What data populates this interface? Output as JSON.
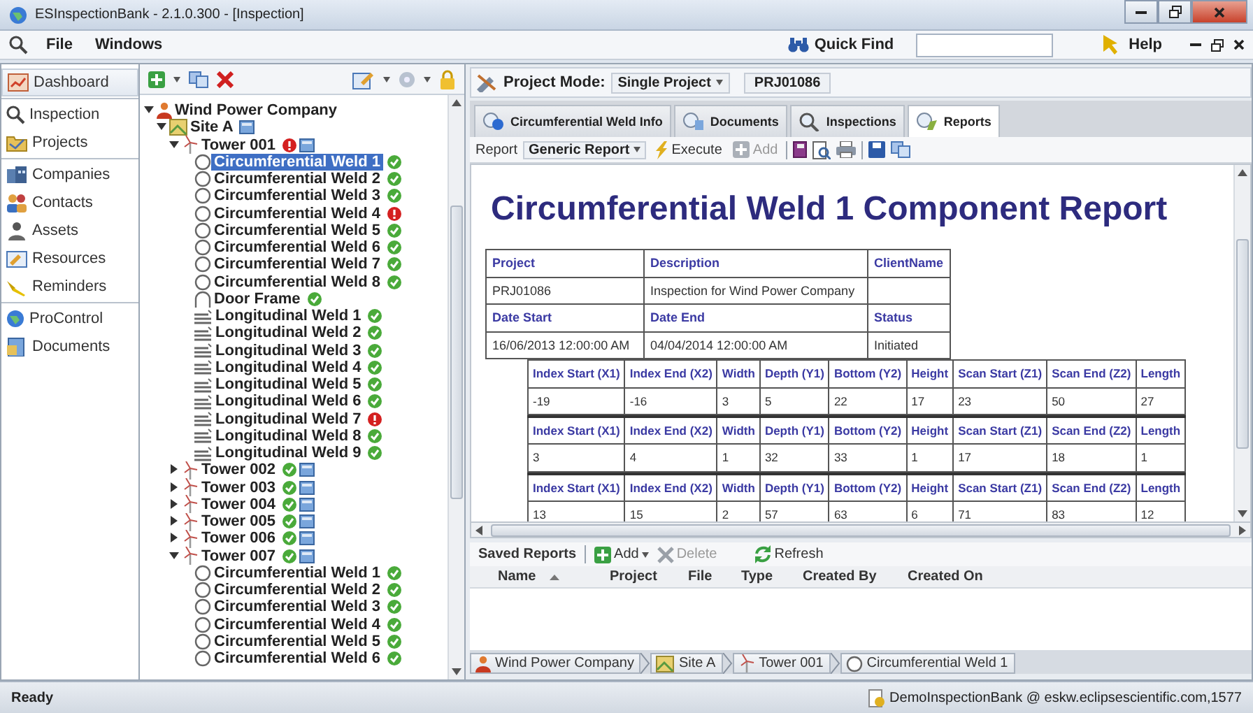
{
  "window": {
    "title": "ESInspectionBank - 2.1.0.300 - [Inspection]"
  },
  "menu": [
    {
      "label": "File"
    },
    {
      "label": "Windows"
    }
  ],
  "quick_find": {
    "label": "Quick Find"
  },
  "help": {
    "label": "Help"
  },
  "nav_groups": [
    [
      {
        "label": "Dashboard",
        "selected": true
      }
    ],
    [
      {
        "label": "Inspection",
        "selected": false
      },
      {
        "label": "Projects",
        "selected": false
      }
    ],
    [
      {
        "label": "Companies",
        "selected": false
      },
      {
        "label": "Contacts",
        "selected": false
      },
      {
        "label": "Assets",
        "selected": false
      },
      {
        "label": "Resources",
        "selected": false
      },
      {
        "label": "Reminders",
        "selected": false
      }
    ],
    [
      {
        "label": "ProControl",
        "selected": false
      },
      {
        "label": "Documents",
        "selected": false
      }
    ]
  ],
  "tree": [
    {
      "label": "Wind Power Company",
      "kind": "company",
      "expanded": true,
      "selected": false,
      "children": [
        {
          "label": "Site A",
          "kind": "site",
          "expanded": true,
          "selected": false,
          "note": true,
          "children": [
            {
              "label": "Tower 001",
              "kind": "tower",
              "expanded": true,
              "selected": false,
              "alert": true,
              "note": true,
              "children": [
                {
                  "label": "Circumferential Weld 1",
                  "kind": "ring",
                  "selected": true,
                  "alert": false
                },
                {
                  "label": "Circumferential Weld 2",
                  "kind": "ring",
                  "selected": false,
                  "alert": false
                },
                {
                  "label": "Circumferential Weld 3",
                  "kind": "ring",
                  "selected": false,
                  "alert": false
                },
                {
                  "label": "Circumferential Weld 4",
                  "kind": "ring",
                  "selected": false,
                  "alert": true
                },
                {
                  "label": "Circumferential Weld 5",
                  "kind": "ring",
                  "selected": false,
                  "alert": false
                },
                {
                  "label": "Circumferential Weld 6",
                  "kind": "ring",
                  "selected": false,
                  "alert": false
                },
                {
                  "label": "Circumferential Weld 7",
                  "kind": "ring",
                  "selected": false,
                  "alert": false
                },
                {
                  "label": "Circumferential Weld 8",
                  "kind": "ring",
                  "selected": false,
                  "alert": false
                },
                {
                  "label": "Door Frame",
                  "kind": "door",
                  "selected": false,
                  "alert": false
                },
                {
                  "label": "Longitudinal Weld 1",
                  "kind": "seam",
                  "selected": false,
                  "alert": false
                },
                {
                  "label": "Longitudinal Weld 2",
                  "kind": "seam",
                  "selected": false,
                  "alert": false
                },
                {
                  "label": "Longitudinal Weld 3",
                  "kind": "seam",
                  "selected": false,
                  "alert": false
                },
                {
                  "label": "Longitudinal Weld 4",
                  "kind": "seam",
                  "selected": false,
                  "alert": false
                },
                {
                  "label": "Longitudinal Weld 5",
                  "kind": "seam",
                  "selected": false,
                  "alert": false
                },
                {
                  "label": "Longitudinal Weld 6",
                  "kind": "seam",
                  "selected": false,
                  "alert": false
                },
                {
                  "label": "Longitudinal Weld 7",
                  "kind": "seam",
                  "selected": false,
                  "alert": true
                },
                {
                  "label": "Longitudinal Weld 8",
                  "kind": "seam",
                  "selected": false,
                  "alert": false
                },
                {
                  "label": "Longitudinal Weld 9",
                  "kind": "seam",
                  "selected": false,
                  "alert": false
                }
              ]
            },
            {
              "label": "Tower 002",
              "kind": "tower",
              "expanded": false,
              "selected": false,
              "alert": false,
              "note": true
            },
            {
              "label": "Tower 003",
              "kind": "tower",
              "expanded": false,
              "selected": false,
              "alert": false,
              "note": true
            },
            {
              "label": "Tower 004",
              "kind": "tower",
              "expanded": false,
              "selected": false,
              "alert": false,
              "note": true
            },
            {
              "label": "Tower 005",
              "kind": "tower",
              "expanded": false,
              "selected": false,
              "alert": false,
              "note": true
            },
            {
              "label": "Tower 006",
              "kind": "tower",
              "expanded": false,
              "selected": false,
              "alert": false,
              "note": true
            },
            {
              "label": "Tower 007",
              "kind": "tower",
              "expanded": true,
              "selected": false,
              "alert": false,
              "note": true,
              "children": [
                {
                  "label": "Circumferential Weld 1",
                  "kind": "ring",
                  "selected": false,
                  "alert": false
                },
                {
                  "label": "Circumferential Weld 2",
                  "kind": "ring",
                  "selected": false,
                  "alert": false
                },
                {
                  "label": "Circumferential Weld 3",
                  "kind": "ring",
                  "selected": false,
                  "alert": false
                },
                {
                  "label": "Circumferential Weld 4",
                  "kind": "ring",
                  "selected": false,
                  "alert": false
                },
                {
                  "label": "Circumferential Weld 5",
                  "kind": "ring",
                  "selected": false,
                  "alert": false
                },
                {
                  "label": "Circumferential Weld 6",
                  "kind": "ring",
                  "selected": false,
                  "alert": false
                }
              ]
            }
          ]
        }
      ]
    }
  ],
  "project_mode": {
    "label": "Project Mode:",
    "value": "Single Project",
    "project": "PRJ01086"
  },
  "tabs": [
    {
      "label": "Circumferential Weld Info",
      "selected": false
    },
    {
      "label": "Documents",
      "selected": false
    },
    {
      "label": "Inspections",
      "selected": false
    },
    {
      "label": "Reports",
      "selected": true
    }
  ],
  "report_toolbar": {
    "label": "Report",
    "report_type": "Generic Report",
    "execute": "Execute",
    "add": {
      "label": "Add",
      "disabled": true
    }
  },
  "report": {
    "title": "Circumferential Weld 1 Component Report",
    "info_rows": [
      {
        "kind": "header",
        "cells": [
          "Project",
          "Description",
          "ClientName"
        ]
      },
      {
        "kind": "value",
        "cells": [
          "PRJ01086",
          "Inspection for Wind Power Company",
          null
        ]
      },
      {
        "kind": "header",
        "cells": [
          "Date Start",
          "Date End",
          "Status"
        ]
      },
      {
        "kind": "value",
        "cells": [
          "16/06/2013 12:00:00 AM",
          "04/04/2014 12:00:00 AM",
          "Initiated"
        ]
      }
    ],
    "measurement_tables": [
      {
        "columns": [
          "Index Start (X1)",
          "Index End (X2)",
          "Width",
          "Depth (Y1)",
          "Bottom (Y2)",
          "Height",
          "Scan Start (Z1)",
          "Scan End (Z2)",
          "Length"
        ],
        "values": [
          "-19",
          "-16",
          "3",
          "5",
          "22",
          "17",
          "23",
          "50",
          "27"
        ]
      },
      {
        "columns": [
          "Index Start (X1)",
          "Index End (X2)",
          "Width",
          "Depth (Y1)",
          "Bottom (Y2)",
          "Height",
          "Scan Start (Z1)",
          "Scan End (Z2)",
          "Length"
        ],
        "values": [
          "3",
          "4",
          "1",
          "32",
          "33",
          "1",
          "17",
          "18",
          "1"
        ]
      },
      {
        "columns": [
          "Index Start (X1)",
          "Index End (X2)",
          "Width",
          "Depth (Y1)",
          "Bottom (Y2)",
          "Height",
          "Scan Start (Z1)",
          "Scan End (Z2)",
          "Length"
        ],
        "values": [
          "13",
          "15",
          "2",
          "57",
          "63",
          "6",
          "71",
          "83",
          "12"
        ]
      }
    ]
  },
  "saved_reports": {
    "title": "Saved Reports",
    "buttons": [
      {
        "kind": "add",
        "label": "Add",
        "disabled": false
      },
      {
        "kind": "delete",
        "label": "Delete",
        "disabled": true
      },
      {
        "kind": "refresh",
        "label": "Refresh",
        "disabled": false
      }
    ],
    "columns": [
      {
        "label": "Name",
        "sorted": true
      },
      {
        "label": "Project",
        "sorted": false
      },
      {
        "label": "File",
        "sorted": false
      },
      {
        "label": "Type",
        "sorted": false
      },
      {
        "label": "Created By",
        "sorted": false
      },
      {
        "label": "Created On",
        "sorted": false
      }
    ]
  },
  "breadcrumb": [
    {
      "label": "Wind Power Company",
      "kind": "company"
    },
    {
      "label": "Site A",
      "kind": "site"
    },
    {
      "label": "Tower 001",
      "kind": "tower"
    },
    {
      "label": "Circumferential Weld 1",
      "kind": "ring"
    }
  ],
  "status_bar": {
    "text": "Ready",
    "connection": "DemoInspectionBank @ eskw.eclipsescientific.com,1577"
  }
}
